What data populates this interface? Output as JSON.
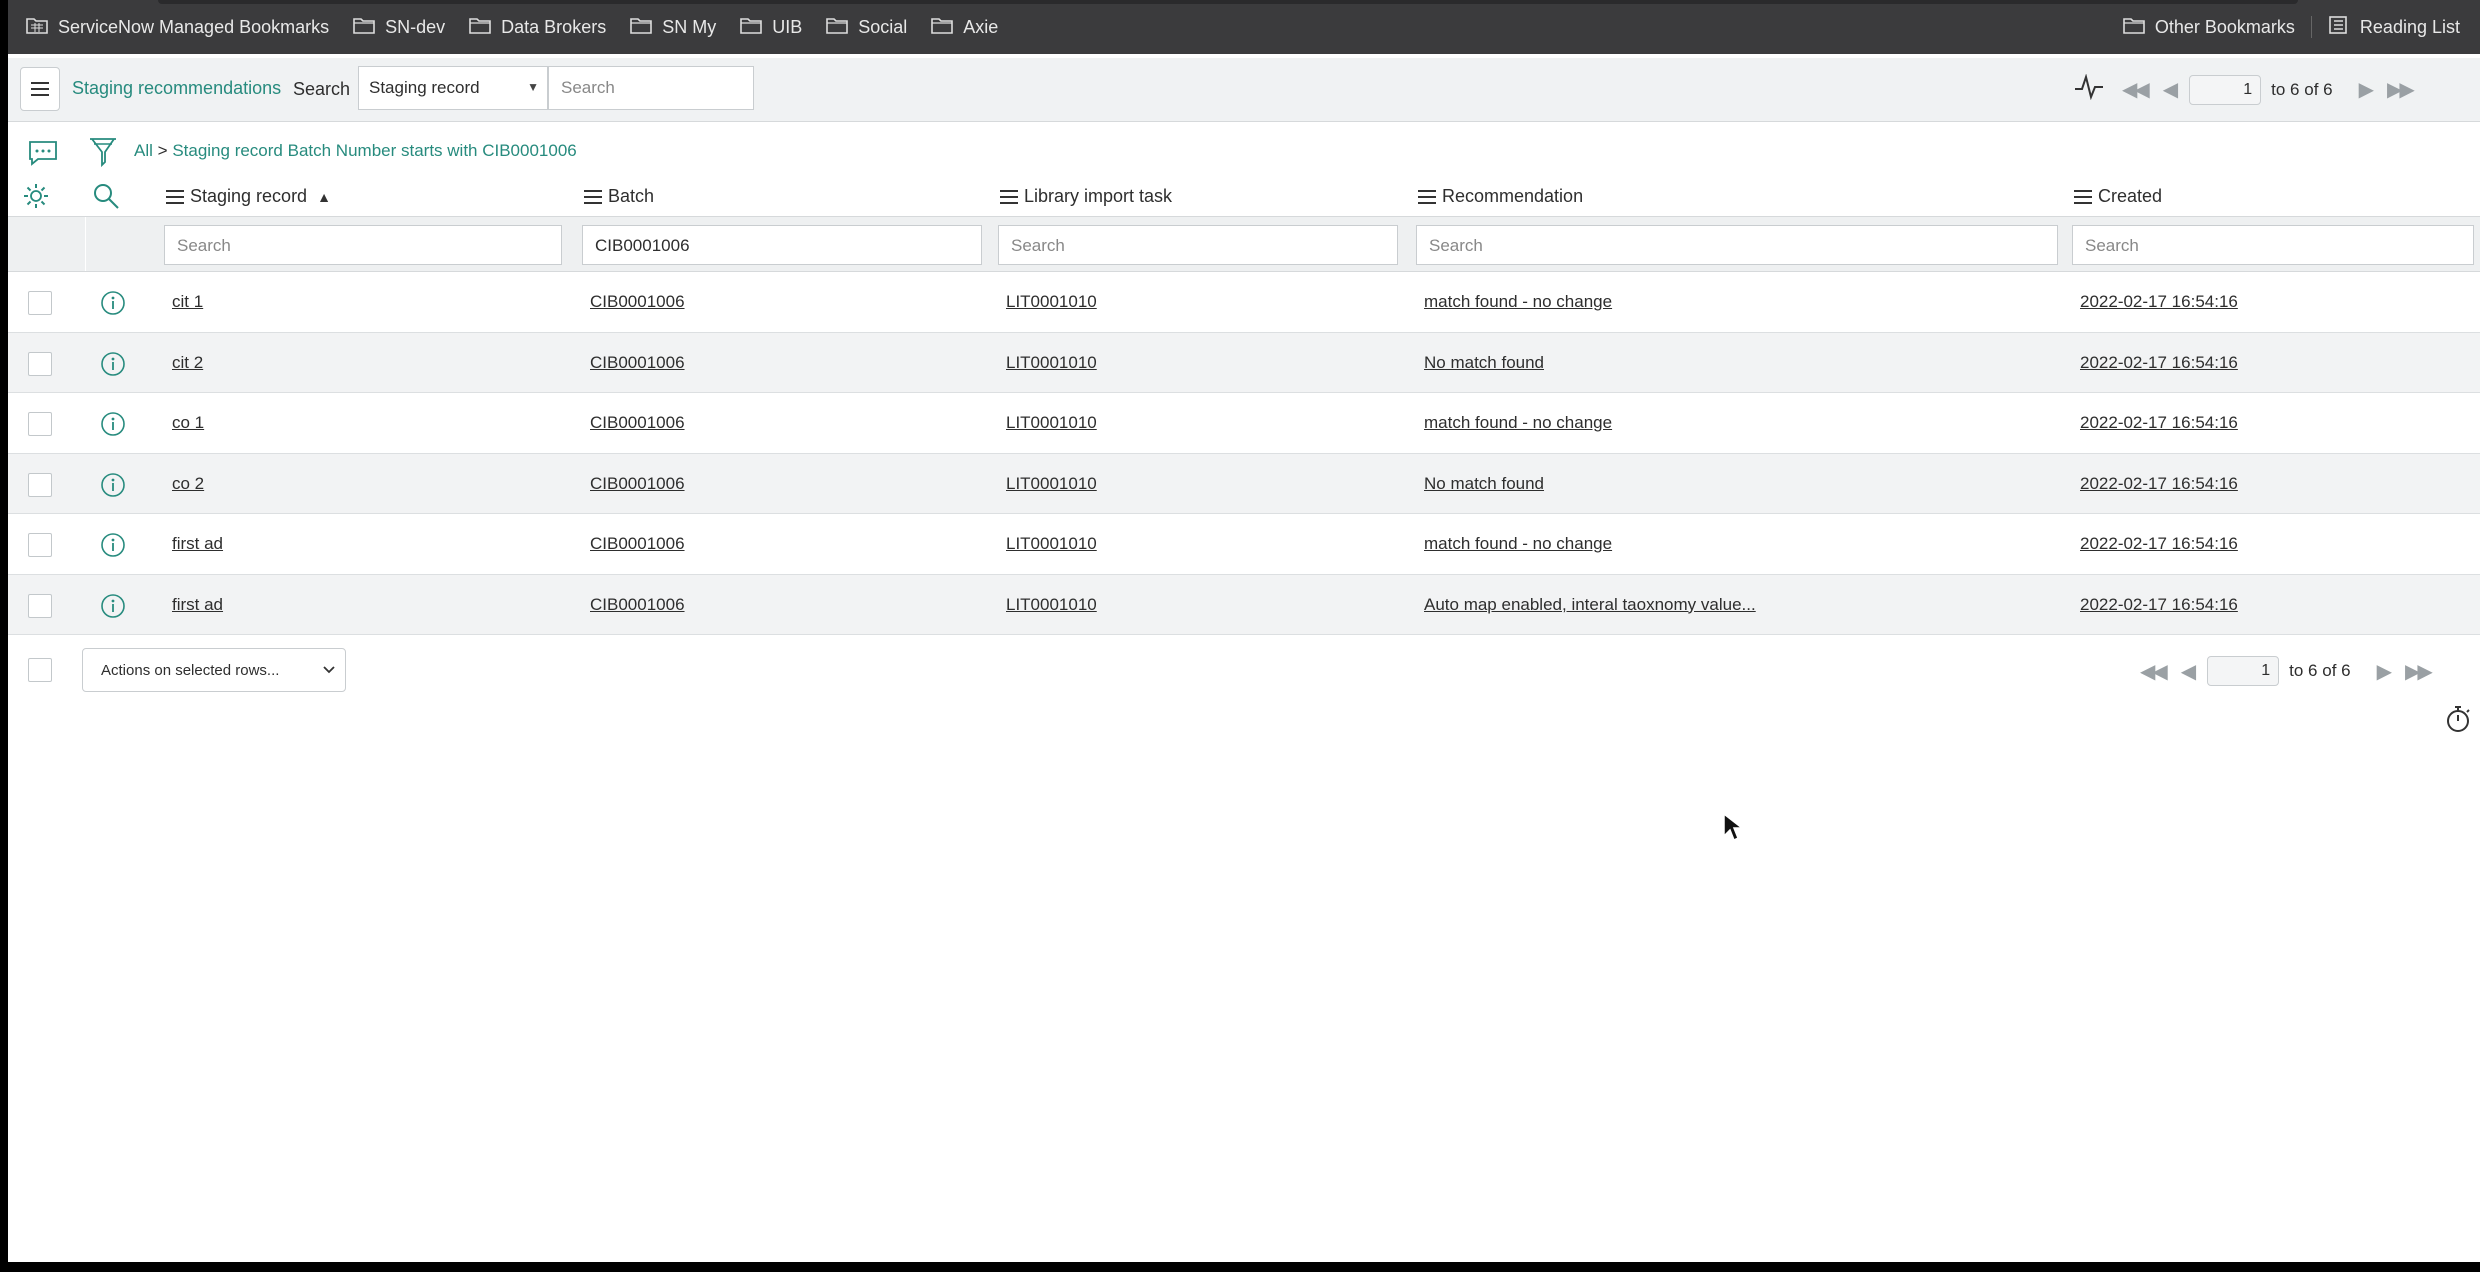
{
  "bookmarks": {
    "items": [
      {
        "label": "ServiceNow Managed Bookmarks",
        "icon": "folder-grid-icon"
      },
      {
        "label": "SN-dev",
        "icon": "folder-icon"
      },
      {
        "label": "Data Brokers",
        "icon": "folder-icon"
      },
      {
        "label": "SN My",
        "icon": "folder-icon"
      },
      {
        "label": "UIB",
        "icon": "folder-icon"
      },
      {
        "label": "Social",
        "icon": "folder-icon"
      },
      {
        "label": "Axie",
        "icon": "folder-icon"
      }
    ],
    "other": "Other Bookmarks",
    "reading_list": "Reading List"
  },
  "header": {
    "title": "Staging recommendations",
    "search_label": "Search",
    "search_field": "Staging record",
    "search_placeholder": "Search",
    "page": "1",
    "range": "to 6 of 6"
  },
  "breadcrumb": {
    "all": "All",
    "separator": ">",
    "filter": "Staging record Batch Number starts with CIB0001006"
  },
  "columns": [
    {
      "label": "Staging record",
      "filter_value": "",
      "filter_placeholder": "Search"
    },
    {
      "label": "Batch",
      "filter_value": "CIB0001006",
      "filter_placeholder": "Search"
    },
    {
      "label": "Library import task",
      "filter_value": "",
      "filter_placeholder": "Search"
    },
    {
      "label": "Recommendation",
      "filter_value": "",
      "filter_placeholder": "Search"
    },
    {
      "label": "Created",
      "filter_value": "",
      "filter_placeholder": "Search"
    }
  ],
  "rows": [
    {
      "record": "cit 1",
      "batch": "CIB0001006",
      "task": "LIT0001010",
      "recommendation": "match found - no change",
      "created": "2022-02-17 16:54:16"
    },
    {
      "record": "cit 2",
      "batch": "CIB0001006",
      "task": "LIT0001010",
      "recommendation": "No match found",
      "created": "2022-02-17 16:54:16"
    },
    {
      "record": "co 1",
      "batch": "CIB0001006",
      "task": "LIT0001010",
      "recommendation": "match found - no change",
      "created": "2022-02-17 16:54:16"
    },
    {
      "record": "co 2",
      "batch": "CIB0001006",
      "task": "LIT0001010",
      "recommendation": "No match found",
      "created": "2022-02-17 16:54:16"
    },
    {
      "record": "first ad",
      "batch": "CIB0001006",
      "task": "LIT0001010",
      "recommendation": "match found - no change",
      "created": "2022-02-17 16:54:16"
    },
    {
      "record": "first ad",
      "batch": "CIB0001006",
      "task": "LIT0001010",
      "recommendation": "Auto map enabled, interal taoxnomy value...",
      "created": "2022-02-17 16:54:16"
    }
  ],
  "footer": {
    "actions_label": "Actions on selected rows...",
    "page": "1",
    "range": "to 6 of 6"
  },
  "colors": {
    "accent": "#278b7e",
    "bookmarks_bg": "#3b3b3d",
    "header_bg": "#f0f2f3"
  }
}
